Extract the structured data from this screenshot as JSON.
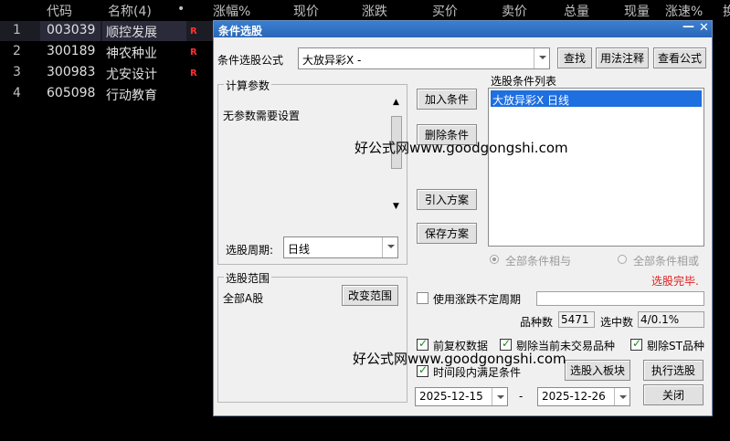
{
  "table": {
    "headers": [
      "代码",
      "名称(4)",
      "•",
      "涨幅%",
      "现价",
      "涨跌",
      "买价",
      "卖价",
      "总量",
      "现量",
      "涨速%",
      "换"
    ],
    "rows": [
      {
        "idx": "1",
        "code": "003039",
        "name": "顺控发展",
        "badge": "R"
      },
      {
        "idx": "2",
        "code": "300189",
        "name": "神农种业",
        "badge": "R"
      },
      {
        "idx": "3",
        "code": "300983",
        "name": "尤安设计",
        "badge": "R"
      },
      {
        "idx": "4",
        "code": "605098",
        "name": "行动教育",
        "badge": ""
      }
    ]
  },
  "dialog": {
    "title": "条件选股",
    "min_btn": "—",
    "close_btn": "✕",
    "formula_label": "条件选股公式",
    "formula_value": "大放异彩X  -",
    "find_btn": "查找",
    "usage_btn": "用法注释",
    "view_btn": "查看公式",
    "params_group": "计算参数",
    "params_text": "无参数需要设置",
    "period_label": "选股周期:",
    "period_value": "日线",
    "add_btn": "加入条件",
    "delete_btn": "删除条件",
    "import_btn": "引入方案",
    "save_btn": "保存方案",
    "list_label": "选股条件列表",
    "list_items": [
      "大放异彩X  日线"
    ],
    "radio_and": "全部条件相与",
    "radio_or": "全部条件相或",
    "status": "选股完毕.",
    "range_group": "选股范围",
    "range_text": "全部A股",
    "change_range_btn": "改变范围",
    "use_period_label": "使用涨跌不定周期",
    "count_label": "品种数",
    "count_value": "5471",
    "selected_label": "选中数",
    "selected_value": "4/0.1%",
    "pre_adj_label": "前复权数据",
    "exclude_nontrade_label": "剔除当前未交易品种",
    "exclude_st_label": "剔除ST品种",
    "time_cond_label": "时间段内满足条件",
    "to_block_btn": "选股入板块",
    "exec_btn": "执行选股",
    "date_from": "2025-12-15",
    "date_sep": "-",
    "date_to": "2025-12-26",
    "close_btn2": "关闭"
  },
  "watermarks": [
    "好公式网www.goodgongshi.com",
    "好公式网www.goodgongshi.com"
  ],
  "colors": {
    "title_bar": "#2a67b8",
    "list_selection": "#1e6fe0",
    "status_red": "#e02020",
    "badge_red": "#ff3030"
  }
}
